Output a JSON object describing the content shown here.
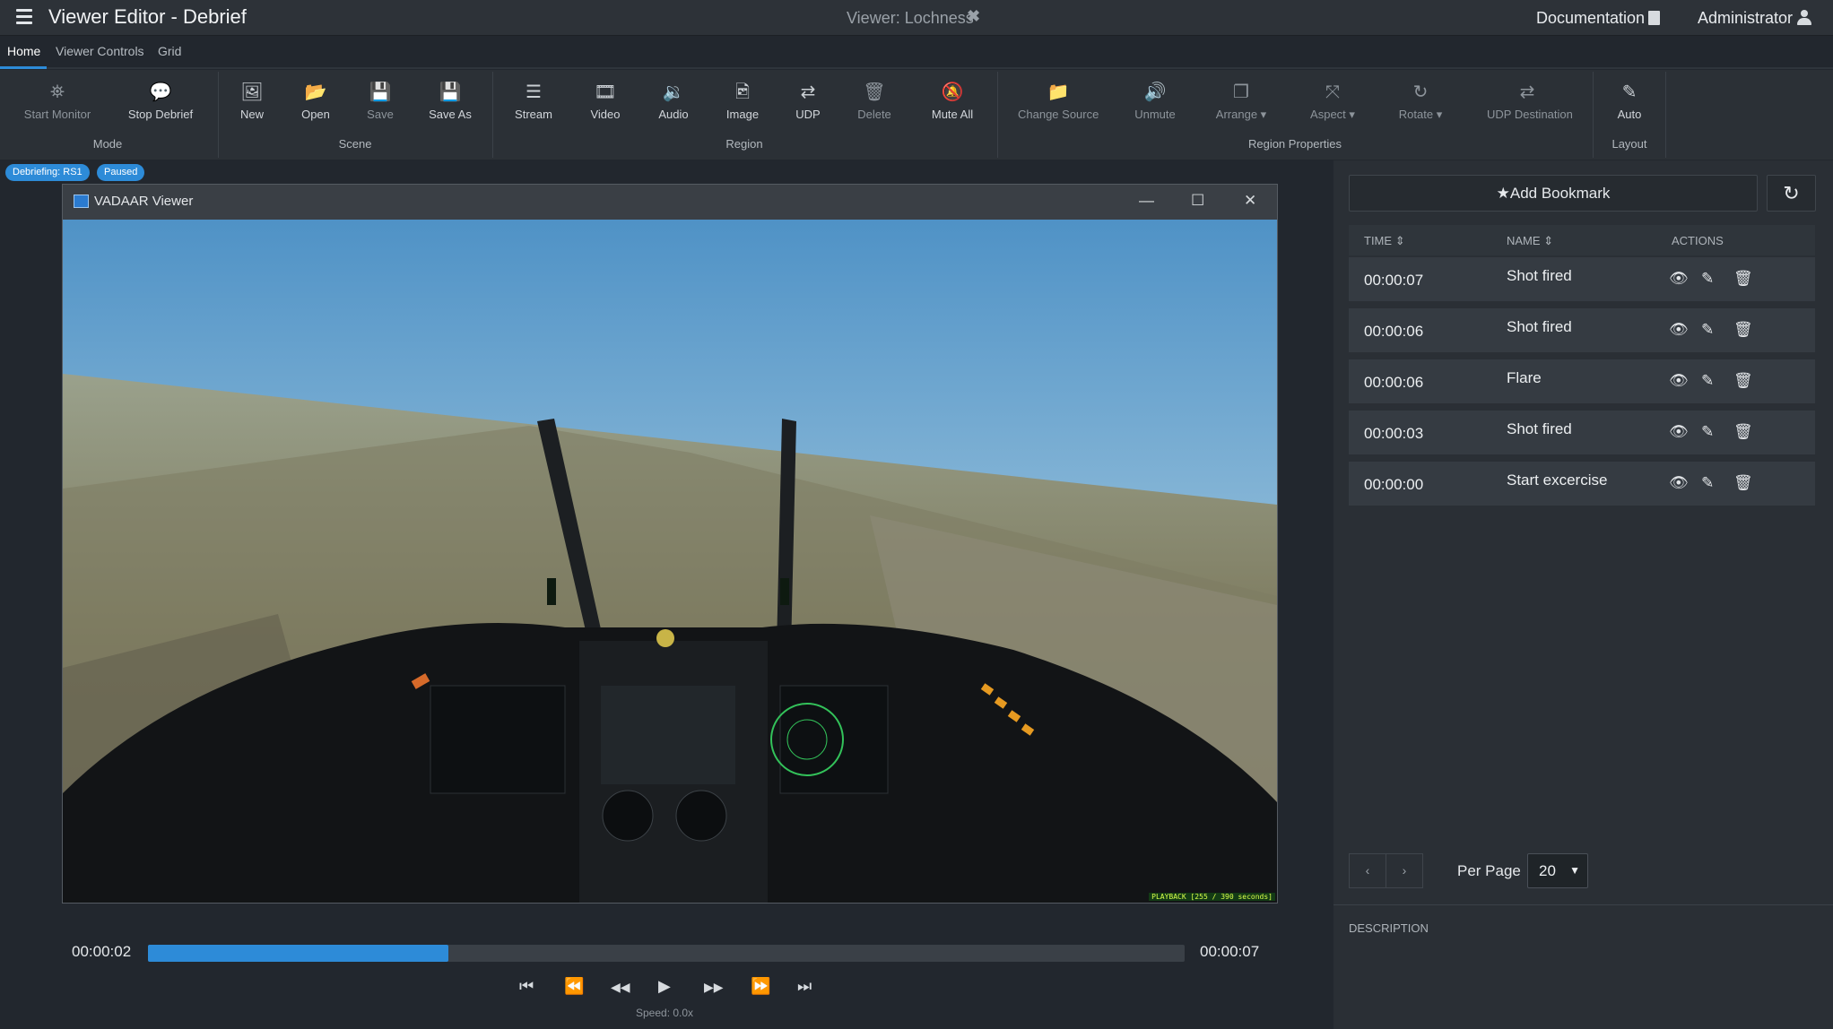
{
  "app": {
    "title": "Viewer Editor - Debrief",
    "viewer_label": "Viewer: Lochness",
    "viewer_close": "✖",
    "documentation": "Documentation",
    "user": "Administrator"
  },
  "tabs": [
    {
      "label": "Home",
      "active": true
    },
    {
      "label": "Viewer Controls",
      "active": false
    },
    {
      "label": "Grid",
      "active": false
    }
  ],
  "ribbon": {
    "buttons": [
      {
        "label": "Start Monitor",
        "icon": "binoculars-icon",
        "glyph": "⛯",
        "enabled": false
      },
      {
        "label": "Stop Debrief",
        "icon": "comments-icon",
        "glyph": "💬",
        "enabled": true
      },
      {
        "label": "New",
        "icon": "image-icon",
        "glyph": "🖼",
        "enabled": true
      },
      {
        "label": "Open",
        "icon": "folder-open-icon",
        "glyph": "📂",
        "enabled": true
      },
      {
        "label": "Save",
        "icon": "floppy-icon",
        "glyph": "💾",
        "enabled": false
      },
      {
        "label": "Save As",
        "icon": "floppy-icon",
        "glyph": "💾",
        "enabled": true
      },
      {
        "label": "Stream",
        "icon": "stream-icon",
        "glyph": "☰",
        "enabled": true
      },
      {
        "label": "Video",
        "icon": "video-file-icon",
        "glyph": "🎞",
        "enabled": true
      },
      {
        "label": "Audio",
        "icon": "audio-file-icon",
        "glyph": "🔉",
        "enabled": true
      },
      {
        "label": "Image",
        "icon": "image-file-icon",
        "glyph": "🖻",
        "enabled": true
      },
      {
        "label": "UDP",
        "icon": "exchange-icon",
        "glyph": "⇄",
        "enabled": true
      },
      {
        "label": "Delete",
        "icon": "trash-icon",
        "glyph": "🗑",
        "enabled": false
      },
      {
        "label": "Mute All",
        "icon": "bell-slash-icon",
        "glyph": "🔕",
        "enabled": true
      },
      {
        "label": "Change Source",
        "icon": "folder-icon",
        "glyph": "📁",
        "enabled": false
      },
      {
        "label": "Unmute",
        "icon": "volume-icon",
        "glyph": "🔊",
        "enabled": false
      },
      {
        "label": "Arrange",
        "icon": "clone-icon",
        "glyph": "❐",
        "enabled": false,
        "dropdown": "▾"
      },
      {
        "label": "Aspect",
        "icon": "expand-icon",
        "glyph": "⤧",
        "enabled": false,
        "dropdown": "▾"
      },
      {
        "label": "Rotate",
        "icon": "refresh-icon",
        "glyph": "↻",
        "enabled": false,
        "dropdown": "▾"
      },
      {
        "label": "UDP Destination",
        "icon": "exchange-icon",
        "glyph": "⇄",
        "enabled": false
      },
      {
        "label": "Auto",
        "icon": "magic-icon",
        "glyph": "✎",
        "enabled": true
      }
    ],
    "groups": [
      "Mode",
      "Scene",
      "Region",
      "Region Properties",
      "Layout"
    ]
  },
  "badges": [
    "Debriefing: RS1",
    "Paused"
  ],
  "viewer_window": {
    "title": "VADAAR Viewer",
    "minimize": "—",
    "maximize": "☐",
    "close": "✕",
    "playback_tag": "PLAYBACK [255 / 390 seconds]"
  },
  "player": {
    "current_time": "00:00:02",
    "end_time": "00:00:07",
    "progress": 0.29,
    "speed": "Speed: 0.0x",
    "controls": [
      {
        "name": "skip-start",
        "glyph": "⏮"
      },
      {
        "name": "fast-backward",
        "glyph": "⏪"
      },
      {
        "name": "backward",
        "glyph": "◀◀"
      },
      {
        "name": "play",
        "glyph": "▶"
      },
      {
        "name": "forward",
        "glyph": "▶▶"
      },
      {
        "name": "fast-forward",
        "glyph": "⏩"
      },
      {
        "name": "skip-end",
        "glyph": "⏭"
      }
    ]
  },
  "bookmarks": {
    "add_label": "Add Bookmark",
    "columns": [
      "TIME",
      "NAME",
      "ACTIONS"
    ],
    "rows": [
      {
        "time": "00:00:07",
        "name": "Shot fired"
      },
      {
        "time": "00:00:06",
        "name": "Shot fired"
      },
      {
        "time": "00:00:06",
        "name": "Flare"
      },
      {
        "time": "00:00:03",
        "name": "Shot fired"
      },
      {
        "time": "00:00:00",
        "name": "Start excercise"
      }
    ],
    "prev": "‹",
    "next": "›",
    "per_page_label": "Per Page",
    "per_page_value": "20",
    "description_label": "DESCRIPTION"
  },
  "colors": {
    "accent": "#2d8bd8",
    "background": "#22272e",
    "panel": "#2a2f35"
  }
}
